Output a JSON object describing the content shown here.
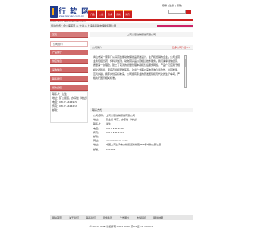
{
  "logo": {
    "title": "行 软 网",
    "url": "www.laoruan.com.cn",
    "slogan": "中国企业及产品在线信息服务平台"
  },
  "top_links": "登录 | 注册 | 帮助",
  "nav": [
    "产品",
    "企业",
    "供求",
    "商机",
    "资讯"
  ],
  "breadcrumb": "您的位置：企业库首页 > 企业 > 上海秦恩动物保健有限公司",
  "sidebar": {
    "items": [
      "首页",
      "公司简介",
      "产品展厅",
      "供应信息",
      "采购信息",
      "联系我们",
      "留言反馈"
    ]
  },
  "contact_box": {
    "person": "联系人：先生",
    "address": "地址：矿业街道，办事处（地址）",
    "phone": "电话：0817-5424925",
    "fax": "传真：0817-5424292",
    "email": "邮箱："
  },
  "main": {
    "company_title": "上海秦恩动物保健有限公司",
    "intro_heading": "公司简介",
    "intro_more": "更多公司介绍>>",
    "intro_text": "青山市某一家专门从事高性能动物保健品研发设计、生产和经销的企业。公司主营业务包括兽药、饲料添加剂、动物营养品以及相关技术服务。我们秉承诚信经营、质量第一的理念，建立了完善的质量管理体系和售后服务网络，产品广泛应用于规模化养殖场、家庭农场和宠物医院。欢迎广大客户来电咨询洽谈合作，共同发展，互利共赢，携手共创美好未来。公司拥有专业的研发团队和现代化的生产车间，严格执行国家相关标准。",
    "contact_heading": "联系方式",
    "details": [
      {
        "label": "公司名称：",
        "value": "上海秦恩动物保健有限公司"
      },
      {
        "label": "地址：",
        "value": "矿业街 号东，办事处（地址）"
      },
      {
        "label": "联系人：",
        "value": "先生"
      },
      {
        "label": "电话：",
        "value": "0817-5424925"
      },
      {
        "label": "传真：",
        "value": "0817-5424292"
      },
      {
        "label": "邮箱：",
        "value": ""
      },
      {
        "label": "网址：",
        "value": "www.zl-trees.com"
      },
      {
        "label": "地址：",
        "value": "中国上海上海市方松街道新松路888号中欣大厦二层"
      },
      {
        "label": "邮编：",
        "value": "201602"
      }
    ]
  },
  "footer": {
    "links": [
      "网站首页",
      "关于我们",
      "联系我们",
      "服务条款",
      "广告服务",
      "友情链接",
      "网站地图"
    ],
    "copyright": "© 2010-2018 版权所有 1997-2019 京ICP证 02-000011"
  }
}
